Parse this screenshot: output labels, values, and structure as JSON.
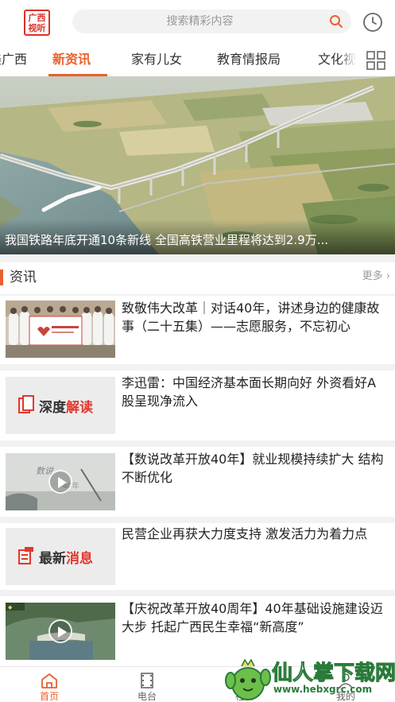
{
  "header": {
    "logo_line1": "广西",
    "logo_line2": "视听",
    "search_placeholder": "搜索精彩内容",
    "search_icon": "search-icon",
    "history_icon": "clock-icon"
  },
  "tabs": [
    {
      "label": "美广西",
      "active": false
    },
    {
      "label": "新资讯",
      "active": true
    },
    {
      "label": "家有儿女",
      "active": false
    },
    {
      "label": "教育情报局",
      "active": false
    },
    {
      "label": "文化视",
      "active": false
    }
  ],
  "tabs_grid_icon": "grid-icon",
  "banner": {
    "caption": "我国铁路年底开通10条新线 全国高铁营业里程将达到2.9万..."
  },
  "section": {
    "title": "资讯",
    "more": "更多"
  },
  "news": [
    {
      "title": "致敬伟大改革｜对话40年，讲述身边的健康故事（二十五集）——志愿服务，不忘初心",
      "thumb": "group-photo",
      "video": false
    },
    {
      "title": "李迅雷：中国经济基本面长期向好 外资看好A股呈现净流入",
      "thumb": "深度解读",
      "thumb_plain": "深度",
      "thumb_accent": "解读",
      "video": false
    },
    {
      "title": "【数说改革开放40年】就业规模持续扩大 结构不断优化",
      "thumb": "video-still",
      "video": true
    },
    {
      "title": "民营企业再获大力度支持 激发活力为着力点",
      "thumb": "最新消息",
      "thumb_plain": "最新",
      "thumb_accent": "消息",
      "video": false
    },
    {
      "title": "【庆祝改革开放40周年】40年基础设施建设迈大步 托起广西民生幸福“新高度”",
      "thumb": "dam-aerial",
      "video": true
    }
  ],
  "bottom_nav": [
    {
      "label": "首页",
      "icon": "home-icon",
      "active": true
    },
    {
      "label": "电台",
      "icon": "film-icon",
      "active": false
    },
    {
      "label": "社群",
      "icon": "community-icon",
      "active": false
    },
    {
      "label": "我的",
      "icon": "user-icon",
      "active": false
    }
  ],
  "watermark": {
    "title": "仙人掌下载网",
    "url": "www.hebxgrc.com"
  },
  "colors": {
    "accent": "#e8612c",
    "logo_red": "#d9322a"
  }
}
